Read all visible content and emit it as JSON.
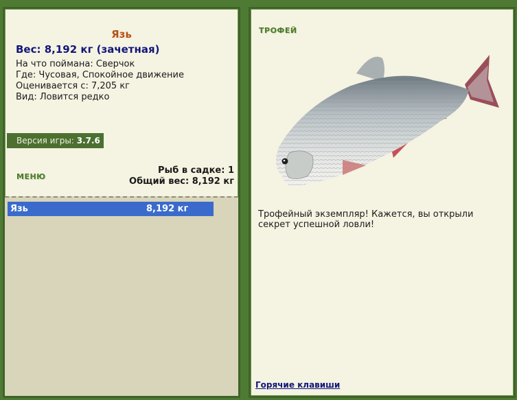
{
  "fish": {
    "name": "Язь",
    "weight": "Вес: 8,192 кг (зачетная)",
    "caught_on": "На что поймана: Сверчок",
    "where": "Где: Чусовая, Спокойное движение",
    "value": "Оценивается с: 7,205 кг",
    "kind": "Вид: Ловится редко"
  },
  "version": {
    "label": "Версия игры: ",
    "value": "3.7.6"
  },
  "menu_label": "МЕНЮ",
  "keepnet": {
    "count": "Рыб в садке: 1",
    "total": "Общий вес: 8,192 кг",
    "rows": [
      {
        "name": "Язь",
        "weight": "8,192 кг"
      }
    ]
  },
  "trophy": {
    "label": "ТРОФЕЙ",
    "text": "Трофейный экземпляр! Кажется, вы открыли секрет успешной ловли!"
  },
  "hotkeys_link": "Горячие клавиши",
  "colors": {
    "frame_green": "#4f7a34",
    "panel_bg": "#f5f3e2",
    "selection_blue": "#3a6bcc",
    "fish_name_orange": "#b5521a",
    "weight_navy": "#12167a"
  }
}
